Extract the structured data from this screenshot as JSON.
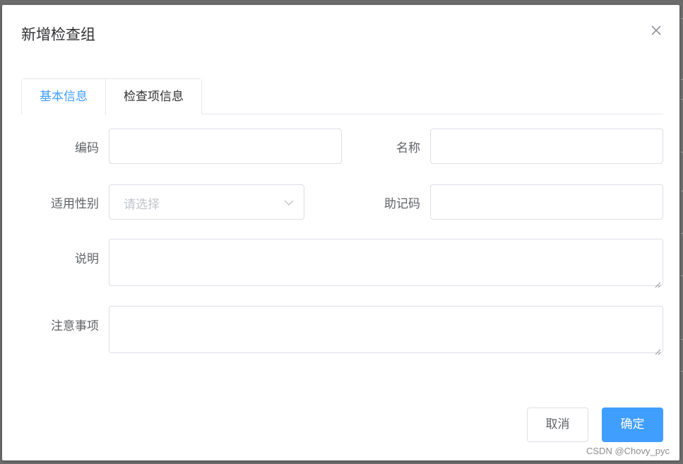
{
  "dialog": {
    "title": "新增检查组",
    "close_icon": "close-icon"
  },
  "tabs": [
    {
      "label": "基本信息",
      "active": true
    },
    {
      "label": "检查项信息",
      "active": false
    }
  ],
  "form": {
    "code": {
      "label": "编码",
      "value": ""
    },
    "name": {
      "label": "名称",
      "value": ""
    },
    "gender": {
      "label": "适用性别",
      "placeholder": "请选择",
      "value": ""
    },
    "mnemonic": {
      "label": "助记码",
      "value": ""
    },
    "description": {
      "label": "说明",
      "value": ""
    },
    "notes": {
      "label": "注意事项",
      "value": ""
    }
  },
  "footer": {
    "cancel_label": "取消",
    "confirm_label": "确定"
  },
  "watermark": "CSDN @Chovy_pyc",
  "colors": {
    "accent": "#409eff",
    "border": "#dcdfe6",
    "text": "#606266",
    "placeholder": "#c0c4cc"
  }
}
